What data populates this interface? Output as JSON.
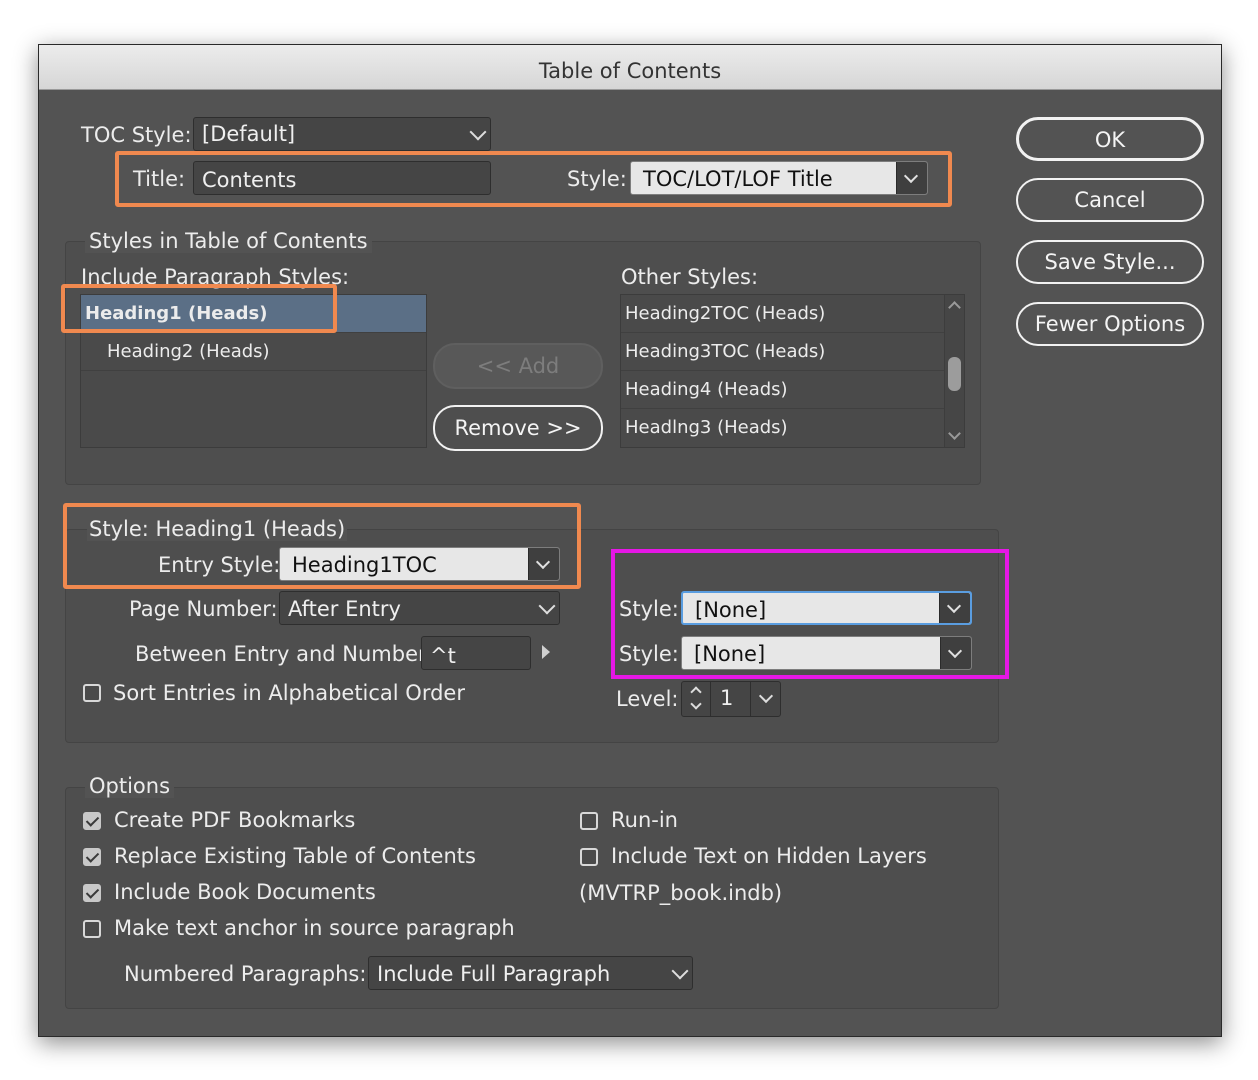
{
  "window": {
    "title": "Table of Contents"
  },
  "toc_style": {
    "label": "TOC Style:",
    "value": "[Default]"
  },
  "title_row": {
    "title_label": "Title:",
    "title_value": "Contents",
    "style_label": "Style:",
    "style_value": "TOC/LOT/LOF Title"
  },
  "styles_group": {
    "heading": "Styles in Table of Contents",
    "include_label": "Include Paragraph Styles:",
    "include_items": [
      "Heading1 (Heads)",
      "Heading2 (Heads)"
    ],
    "other_label": "Other Styles:",
    "other_items": [
      "Heading2TOC (Heads)",
      "Heading3TOC (Heads)",
      "Heading4 (Heads)",
      "Headlng3 (Heads)"
    ],
    "add_label": "<< Add",
    "remove_label": "Remove >>"
  },
  "style_group": {
    "heading": "Style: Heading1 (Heads)",
    "entry_style_label": "Entry Style:",
    "entry_style_value": "Heading1TOC",
    "page_number_label": "Page Number:",
    "page_number_value": "After Entry",
    "between_label": "Between Entry and Number:",
    "between_value": "^t",
    "sort_label": "Sort Entries in Alphabetical Order",
    "style1_label": "Style:",
    "style1_value": "[None]",
    "style2_label": "Style:",
    "style2_value": "[None]",
    "level_label": "Level:",
    "level_value": "1"
  },
  "options": {
    "heading": "Options",
    "create_pdf": "Create PDF Bookmarks",
    "replace_existing": "Replace Existing Table of Contents",
    "include_book": "Include Book Documents",
    "make_anchor": "Make text anchor in source paragraph",
    "run_in": "Run-in",
    "hidden_layers": "Include Text on Hidden Layers",
    "book_name": "(MVTRP_book.indb)",
    "numbered_label": "Numbered Paragraphs:",
    "numbered_value": "Include Full Paragraph"
  },
  "buttons": {
    "ok": "OK",
    "cancel": "Cancel",
    "save_style": "Save Style...",
    "fewer_options": "Fewer Options"
  },
  "colors": {
    "highlight_orange": "#f0894f",
    "highlight_magenta": "#e617e6",
    "selection": "#5b6f86"
  }
}
